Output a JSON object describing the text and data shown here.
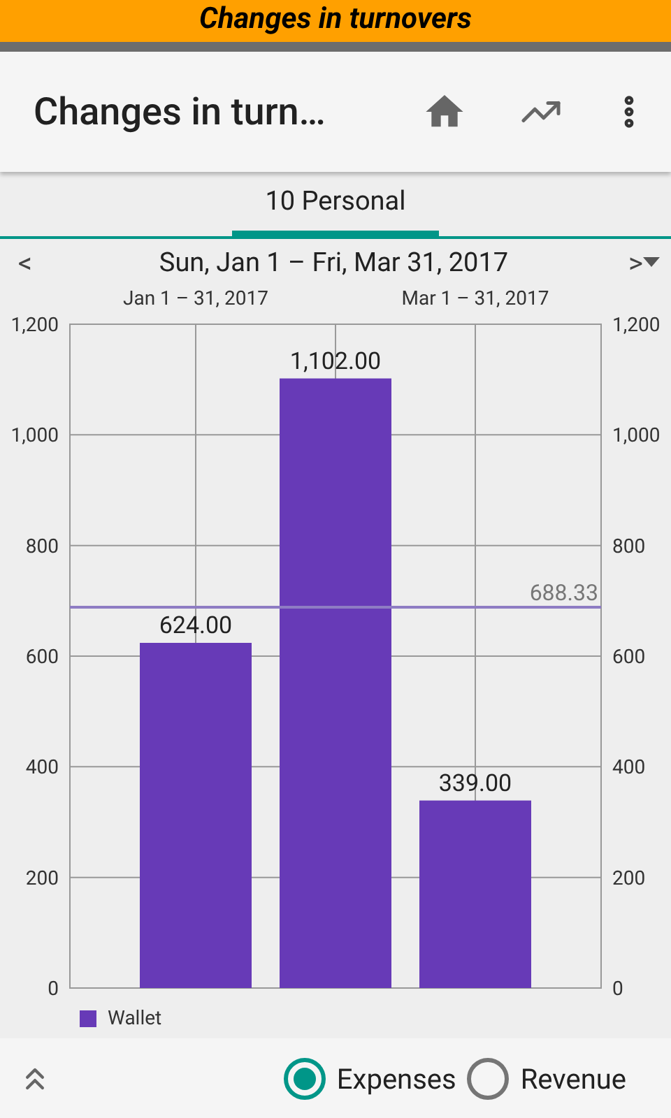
{
  "banner": {
    "title": "Changes in turnovers"
  },
  "app_bar": {
    "title": "Changes in turn…"
  },
  "tabs": [
    {
      "label": "10 Personal",
      "selected": true
    }
  ],
  "period": {
    "prev": "<",
    "label": "Sun, Jan 1 – Fri, Mar 31, 2017",
    "next": ">"
  },
  "chart_data": {
    "type": "bar",
    "categories": [
      "Jan 1 – 31, 2017",
      null,
      "Mar 1 – 31, 2017"
    ],
    "series": [
      {
        "name": "Wallet",
        "color": "#673ab7",
        "values": [
          624,
          1102,
          339
        ]
      }
    ],
    "ylim": [
      0,
      1200
    ],
    "yticks": [
      {
        "value": 0,
        "label": "0"
      },
      {
        "value": 200,
        "label": "200"
      },
      {
        "value": 400,
        "label": "400"
      },
      {
        "value": 600,
        "label": "600"
      },
      {
        "value": 800,
        "label": "800"
      },
      {
        "value": 1000,
        "label": "1,000"
      },
      {
        "value": 1200,
        "label": "1,200"
      }
    ],
    "value_labels": [
      "624.00",
      "1,102.00",
      "339.00"
    ],
    "grid": true,
    "ref_lines": [
      {
        "axis": "y",
        "value": 688.33,
        "label": "688.33",
        "color": "#8e7cc3"
      }
    ]
  },
  "mode_options": [
    {
      "label": "Expenses",
      "selected": true
    },
    {
      "label": "Revenue",
      "selected": false
    }
  ]
}
